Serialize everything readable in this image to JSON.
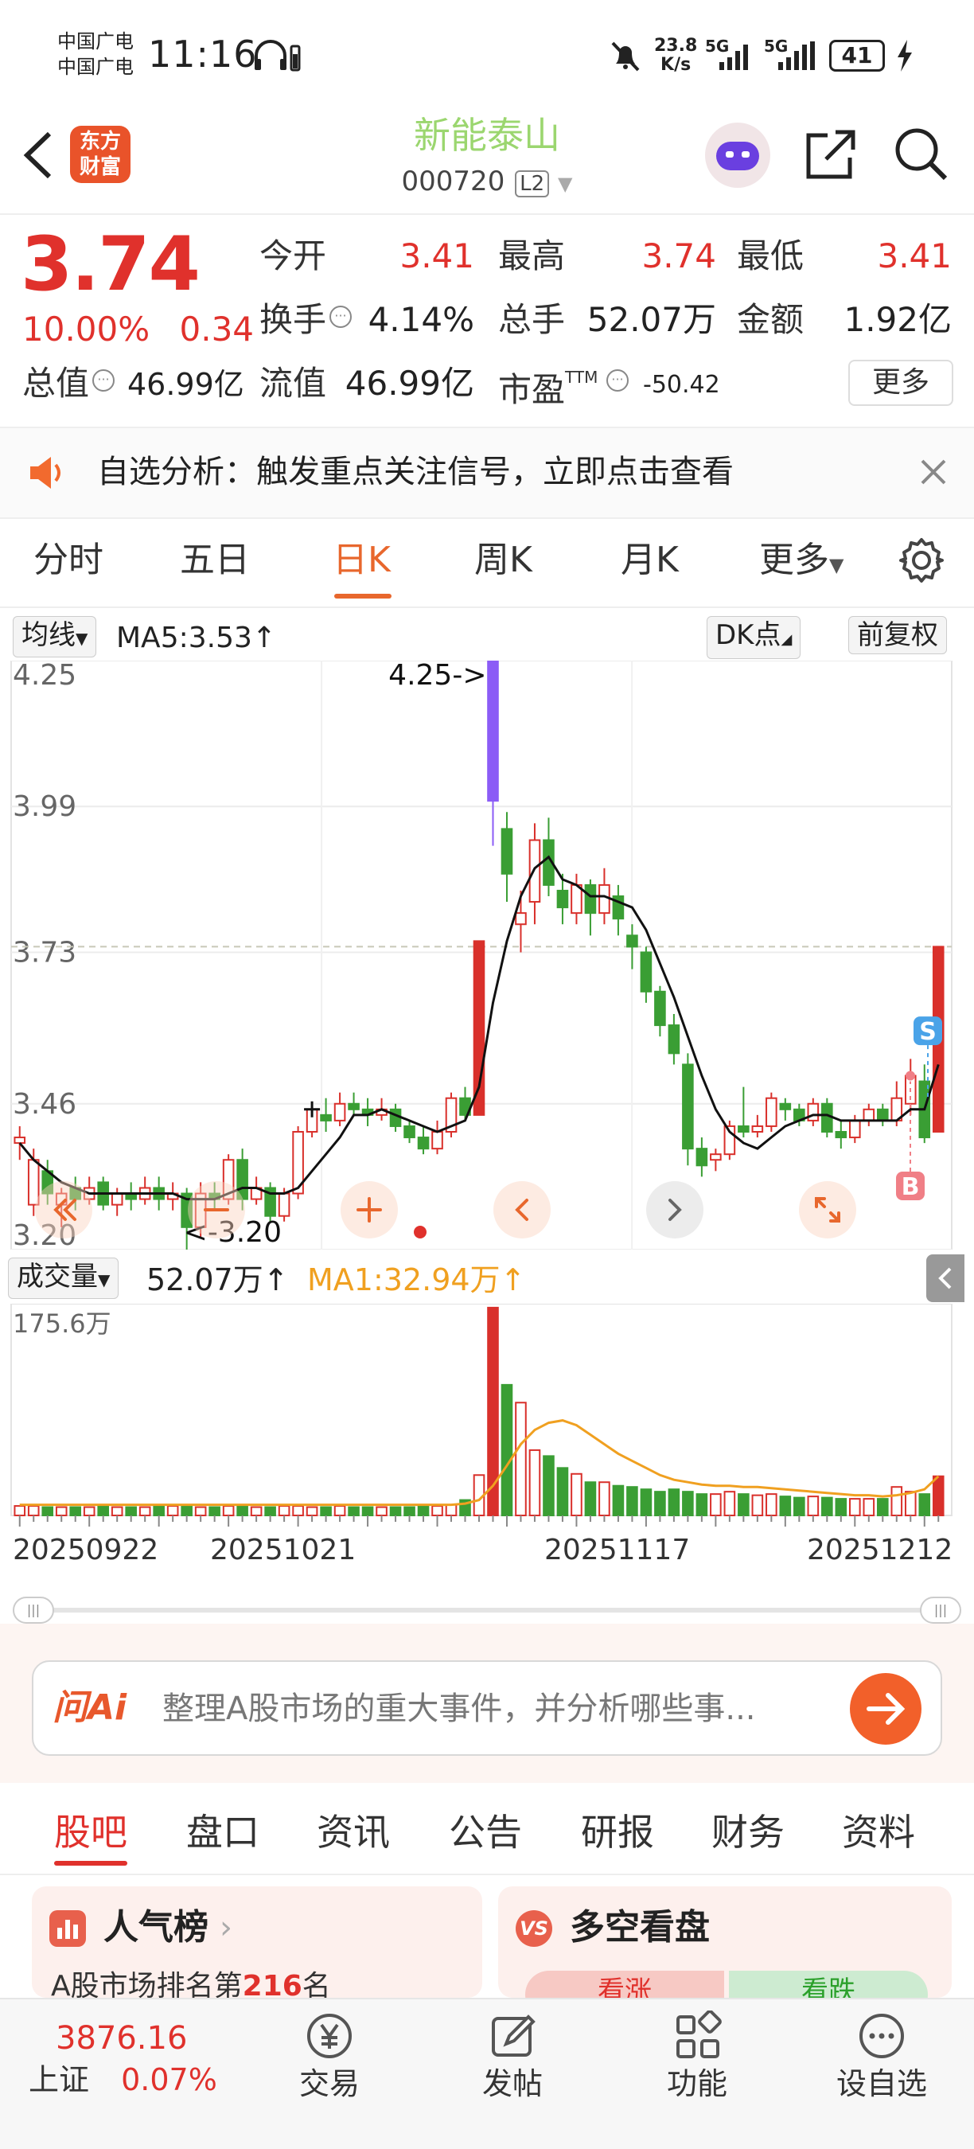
{
  "status_bar": {
    "carrier_1": "中国广电",
    "carrier_2": "中国广电",
    "time": "11:16",
    "net_speed_value": "23.8",
    "net_speed_unit": "K/s",
    "signal_1": "5G",
    "signal_2": "5G",
    "battery": "41"
  },
  "header": {
    "logo_line1": "东方",
    "logo_line2": "财富",
    "stock_name": "新能泰山",
    "stock_code": "000720",
    "level_badge": "L2"
  },
  "quote": {
    "price": "3.74",
    "change_pct": "10.00%",
    "change_abs": "0.34",
    "open_label": "今开",
    "open_value": "3.41",
    "high_label": "最高",
    "high_value": "3.74",
    "low_label": "最低",
    "low_value": "3.41",
    "turnover_label": "换手",
    "turnover_value": "4.14%",
    "volume_label": "总手",
    "volume_value": "52.07万",
    "amount_label": "金额",
    "amount_value": "1.92亿",
    "mcap_label": "总值",
    "mcap_value": "46.99亿",
    "float_label": "流值",
    "float_value": "46.99亿",
    "pe_label": "市盈",
    "pe_sup": "TTM",
    "pe_value": "-50.42",
    "more_button": "更多"
  },
  "alert": {
    "text": "自选分析：触发重点关注信号，立即点击查看"
  },
  "tabs": {
    "items": [
      "分时",
      "五日",
      "日K",
      "周K",
      "月K",
      "更多"
    ],
    "active": "日K"
  },
  "kline": {
    "indicator_select": "均线",
    "ma5_text": "MA5:3.53",
    "dk_button": "DK点",
    "adjust_button": "前复权",
    "y_labels": [
      "4.25",
      "3.99",
      "3.73",
      "3.46",
      "3.20"
    ],
    "high_marker": "4.25->",
    "low_marker": "<-3.20",
    "sell_marker": "S",
    "buy_marker": "B"
  },
  "volume": {
    "indicator_select": "成交量",
    "vol_text": "52.07万",
    "ma1_text": "MA1:32.94万",
    "max_label": "175.6万",
    "dates": [
      "20250922",
      "20251021",
      "20251117",
      "20251212"
    ]
  },
  "ai": {
    "brand": "问Ai",
    "placeholder": "整理A股市场的重大事件，并分析哪些事..."
  },
  "bottom_tabs": {
    "items": [
      "股吧",
      "盘口",
      "资讯",
      "公告",
      "研报",
      "财务",
      "资料"
    ],
    "active": "股吧"
  },
  "cards": {
    "left_title": "人气榜",
    "left_sub_prefix": "A股市场排名第",
    "left_rank": "216",
    "left_sub_suffix": "名",
    "right_title": "多空看盘",
    "right_up": "看涨",
    "right_down": "看跌"
  },
  "footer": {
    "index_value": "3876.16",
    "index_name": "上证",
    "index_change": "0.07%",
    "items": [
      "交易",
      "发帖",
      "功能",
      "设自选"
    ]
  },
  "chart_data": {
    "type": "candlestick",
    "title": "",
    "ylim": [
      3.2,
      4.25
    ],
    "y_ticks": [
      4.25,
      3.99,
      3.73,
      3.46,
      3.2
    ],
    "x_ticks": [
      "20250922",
      "20251021",
      "20251117",
      "20251212"
    ],
    "candles": [
      [
        3.39,
        3.4,
        3.42,
        3.36
      ],
      [
        3.28,
        3.36,
        3.38,
        3.26
      ],
      [
        3.34,
        3.3,
        3.36,
        3.28
      ],
      [
        3.28,
        3.3,
        3.31,
        3.24
      ],
      [
        3.31,
        3.29,
        3.33,
        3.27
      ],
      [
        3.29,
        3.31,
        3.33,
        3.28
      ],
      [
        3.32,
        3.28,
        3.33,
        3.27
      ],
      [
        3.28,
        3.3,
        3.31,
        3.26
      ],
      [
        3.3,
        3.29,
        3.32,
        3.27
      ],
      [
        3.29,
        3.31,
        3.33,
        3.28
      ],
      [
        3.31,
        3.29,
        3.33,
        3.27
      ],
      [
        3.29,
        3.3,
        3.32,
        3.27
      ],
      [
        3.3,
        3.24,
        3.31,
        3.2
      ],
      [
        3.24,
        3.3,
        3.32,
        3.22
      ],
      [
        3.3,
        3.29,
        3.32,
        3.27
      ],
      [
        3.29,
        3.36,
        3.37,
        3.28
      ],
      [
        3.36,
        3.29,
        3.38,
        3.27
      ],
      [
        3.29,
        3.31,
        3.33,
        3.28
      ],
      [
        3.31,
        3.26,
        3.32,
        3.25
      ],
      [
        3.26,
        3.3,
        3.31,
        3.25
      ],
      [
        3.3,
        3.41,
        3.42,
        3.29
      ],
      [
        3.41,
        3.45,
        3.46,
        3.4
      ],
      [
        3.44,
        3.43,
        3.47,
        3.41
      ],
      [
        3.43,
        3.46,
        3.48,
        3.42
      ],
      [
        3.46,
        3.45,
        3.48,
        3.44
      ],
      [
        3.45,
        3.44,
        3.47,
        3.42
      ],
      [
        3.44,
        3.45,
        3.47,
        3.43
      ],
      [
        3.45,
        3.42,
        3.46,
        3.41
      ],
      [
        3.42,
        3.4,
        3.43,
        3.39
      ],
      [
        3.4,
        3.38,
        3.42,
        3.37
      ],
      [
        3.38,
        3.41,
        3.43,
        3.37
      ],
      [
        3.41,
        3.47,
        3.48,
        3.4
      ],
      [
        3.47,
        3.44,
        3.49,
        3.43
      ],
      [
        3.44,
        3.75,
        3.75,
        3.44
      ],
      [
        4.25,
        4.0,
        4.25,
        3.92
      ],
      [
        3.95,
        3.87,
        3.98,
        3.82
      ],
      [
        3.78,
        3.8,
        3.84,
        3.73
      ],
      [
        3.82,
        3.93,
        3.96,
        3.78
      ],
      [
        3.93,
        3.85,
        3.97,
        3.83
      ],
      [
        3.84,
        3.81,
        3.87,
        3.78
      ],
      [
        3.8,
        3.85,
        3.87,
        3.78
      ],
      [
        3.85,
        3.8,
        3.86,
        3.76
      ],
      [
        3.8,
        3.85,
        3.88,
        3.78
      ],
      [
        3.83,
        3.79,
        3.85,
        3.76
      ],
      [
        3.76,
        3.74,
        3.78,
        3.7
      ],
      [
        3.73,
        3.66,
        3.74,
        3.64
      ],
      [
        3.66,
        3.6,
        3.67,
        3.58
      ],
      [
        3.6,
        3.55,
        3.62,
        3.53
      ],
      [
        3.53,
        3.38,
        3.55,
        3.35
      ],
      [
        3.38,
        3.35,
        3.4,
        3.33
      ],
      [
        3.36,
        3.37,
        3.38,
        3.34
      ],
      [
        3.37,
        3.42,
        3.43,
        3.36
      ],
      [
        3.42,
        3.41,
        3.49,
        3.4
      ],
      [
        3.41,
        3.42,
        3.44,
        3.4
      ],
      [
        3.42,
        3.47,
        3.48,
        3.41
      ],
      [
        3.46,
        3.45,
        3.47,
        3.43
      ],
      [
        3.45,
        3.43,
        3.46,
        3.42
      ],
      [
        3.43,
        3.46,
        3.47,
        3.42
      ],
      [
        3.46,
        3.41,
        3.47,
        3.4
      ],
      [
        3.41,
        3.4,
        3.43,
        3.38
      ],
      [
        3.4,
        3.43,
        3.44,
        3.39
      ],
      [
        3.43,
        3.45,
        3.46,
        3.42
      ],
      [
        3.45,
        3.43,
        3.46,
        3.42
      ],
      [
        3.43,
        3.47,
        3.5,
        3.42
      ],
      [
        3.46,
        3.51,
        3.54,
        3.44
      ],
      [
        3.5,
        3.4,
        3.53,
        3.39
      ],
      [
        3.41,
        3.74,
        3.74,
        3.41
      ]
    ],
    "ma5": [
      3.39,
      3.36,
      3.34,
      3.32,
      3.31,
      3.3,
      3.3,
      3.3,
      3.3,
      3.3,
      3.3,
      3.3,
      3.29,
      3.29,
      3.29,
      3.3,
      3.31,
      3.31,
      3.3,
      3.3,
      3.31,
      3.34,
      3.37,
      3.4,
      3.44,
      3.44,
      3.45,
      3.44,
      3.43,
      3.42,
      3.41,
      3.42,
      3.43,
      3.49,
      3.64,
      3.75,
      3.83,
      3.88,
      3.9,
      3.86,
      3.85,
      3.83,
      3.83,
      3.82,
      3.81,
      3.77,
      3.71,
      3.65,
      3.58,
      3.51,
      3.45,
      3.41,
      3.39,
      3.38,
      3.4,
      3.42,
      3.43,
      3.44,
      3.44,
      3.43,
      3.43,
      3.43,
      3.43,
      3.43,
      3.45,
      3.45,
      3.53
    ],
    "volume_ylim": [
      0,
      175.6
    ],
    "volume": [
      8,
      8,
      7,
      7,
      7,
      7,
      8,
      7,
      7,
      7,
      8,
      8,
      8,
      7,
      7,
      8,
      8,
      7,
      7,
      8,
      8,
      7,
      7,
      8,
      7,
      7,
      7,
      7,
      7,
      8,
      8,
      9,
      13,
      34,
      175,
      110,
      95,
      55,
      50,
      40,
      35,
      28,
      28,
      25,
      24,
      22,
      20,
      22,
      20,
      18,
      18,
      20,
      18,
      17,
      18,
      16,
      15,
      16,
      15,
      14,
      14,
      14,
      14,
      24,
      20,
      18,
      33
    ],
    "volume_ma": [
      9,
      9,
      9,
      9,
      9,
      9,
      9,
      9,
      9,
      9,
      9,
      9,
      9,
      9,
      9,
      9,
      9,
      9,
      9,
      9,
      9,
      9,
      9,
      9,
      9,
      9,
      9,
      9,
      9,
      9,
      9,
      9,
      10,
      13,
      25,
      42,
      60,
      72,
      78,
      80,
      76,
      68,
      60,
      52,
      46,
      40,
      34,
      30,
      28,
      26,
      25,
      25,
      24,
      24,
      23,
      22,
      21,
      20,
      19,
      18,
      17,
      17,
      16,
      17,
      19,
      22,
      33
    ]
  }
}
